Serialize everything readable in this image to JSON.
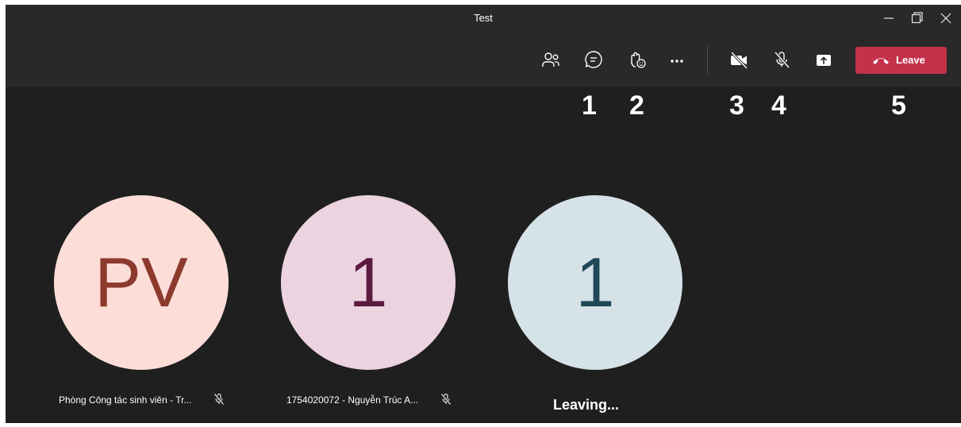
{
  "window": {
    "title": "Test",
    "controls": {
      "minimize": "minimize-icon",
      "restore": "restore-icon",
      "close": "close-icon"
    }
  },
  "toolbar": {
    "buttons": [
      {
        "id": "participants",
        "icon": "participants-icon"
      },
      {
        "id": "chat",
        "icon": "chat-icon"
      },
      {
        "id": "reactions",
        "icon": "raise-hand-icon"
      },
      {
        "id": "more",
        "icon": "more-actions-icon"
      },
      {
        "id": "camera",
        "icon": "camera-off-icon"
      },
      {
        "id": "mic",
        "icon": "mic-off-icon"
      },
      {
        "id": "share",
        "icon": "share-screen-icon"
      }
    ],
    "leave_label": "Leave",
    "leave_icon": "hang-up-icon",
    "leave_color": "#c4314b"
  },
  "markers": [
    "1",
    "2",
    "3",
    "4",
    "5"
  ],
  "participants": [
    {
      "initials": "PV",
      "name": "Phòng Công tác sinh viên - Tr...",
      "muted": true,
      "bg": "#fcddd7",
      "fg": "#8b3a2d"
    },
    {
      "initials": "1",
      "name": "1754020072 - Nguyễn Trúc A...",
      "muted": true,
      "bg": "#ebd3e0",
      "fg": "#5c1a3e"
    },
    {
      "initials": "1",
      "name": "",
      "bg": "#d5e2e7",
      "fg": "#1f4858"
    }
  ],
  "status": {
    "leaving": "Leaving..."
  }
}
